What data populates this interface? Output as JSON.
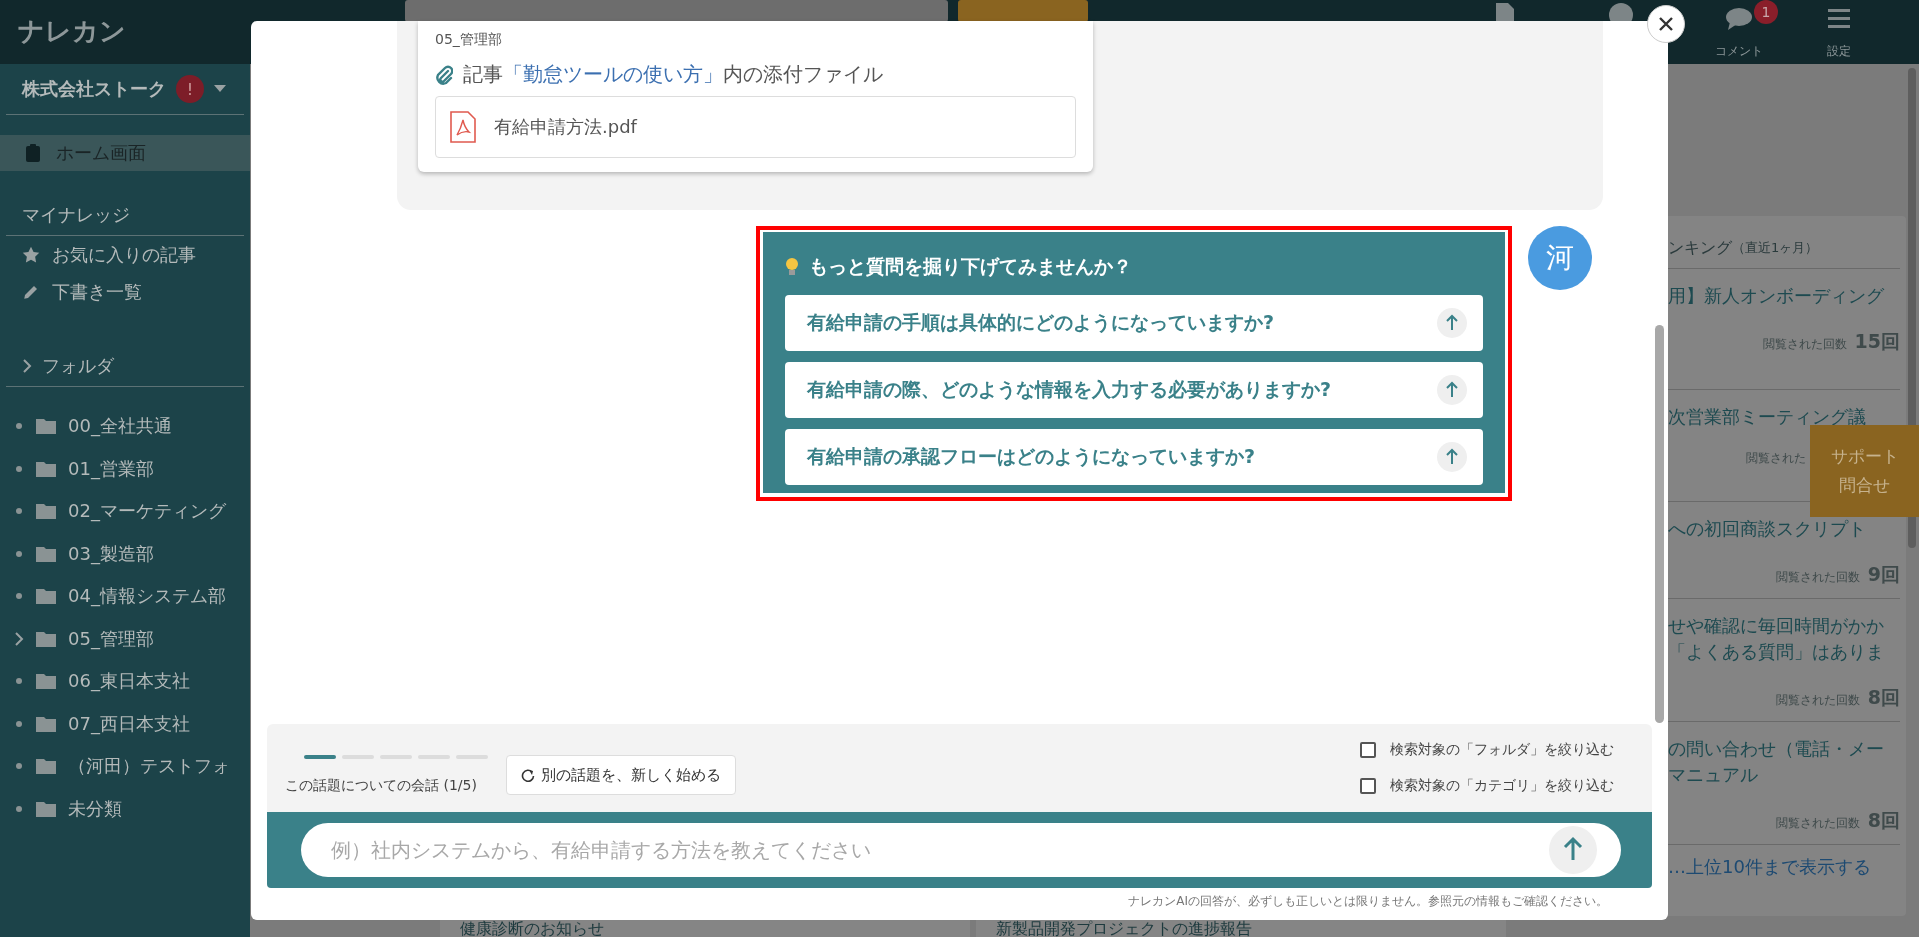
{
  "header": {
    "logo": "ナレカン",
    "comment_badge": "1",
    "comment_label": "コメント",
    "settings_label": "設定"
  },
  "sidebar": {
    "company": "株式会社ストーク",
    "alert_badge": "!",
    "nav": [
      {
        "label": "ホーム画面",
        "selected": true
      }
    ],
    "my_knowledge": {
      "heading": "マイナレッジ",
      "items": [
        {
          "kind": "star",
          "label": "お気に入りの記事"
        },
        {
          "kind": "pencil",
          "label": "下書き一覧"
        }
      ]
    },
    "folders": {
      "heading": "フォルダ",
      "items": [
        {
          "label": "00_全社共通",
          "has_children": false
        },
        {
          "label": "01_営業部",
          "has_children": false
        },
        {
          "label": "02_マーケティング",
          "has_children": false
        },
        {
          "label": "03_製造部",
          "has_children": false
        },
        {
          "label": "04_情報システム部",
          "has_children": false
        },
        {
          "label": "05_管理部",
          "has_children": true
        },
        {
          "label": "06_東日本支社",
          "has_children": false
        },
        {
          "label": "07_西日本支社",
          "has_children": false
        },
        {
          "label": "（河田）テストフォ",
          "has_children": false
        },
        {
          "label": "未分類",
          "has_children": false
        }
      ]
    }
  },
  "background_cards": [
    "健康診断のお知らせ",
    "新製品開発プロジェクトの進捗報告"
  ],
  "ranking": {
    "title": "ンキング",
    "period": "（直近1ヶ月）",
    "items": [
      {
        "lines": [
          "用】新人オンボーディング"
        ],
        "count_label": "閲覧された回数",
        "count": "15回"
      },
      {
        "lines": [
          "次営業部ミーティング議"
        ],
        "count_label": "閲覧された"
      },
      {
        "lines": [
          "への初回商談スクリプト"
        ],
        "count_label": "閲覧された回数",
        "count": "9回"
      },
      {
        "lines": [
          "せや確認に毎回時間がかか",
          "「よくある質問」はありま"
        ],
        "count_label": "閲覧された回数",
        "count": "8回"
      },
      {
        "lines": [
          "の問い合わせ（電話・メー",
          "マニュアル"
        ],
        "count_label": "閲覧された回数",
        "count": "8回"
      }
    ],
    "more_link": "…上位10件まで表示する"
  },
  "support_button": {
    "lines": [
      "サポート",
      "問合せ"
    ]
  },
  "chat": {
    "reference": {
      "folder": "05_管理部",
      "caption_prefix": "記事",
      "article_link": "「勤怠ツールの使い方」",
      "caption_suffix": "内の添付ファイル",
      "file": "有給申請方法.pdf"
    },
    "suggestions": {
      "title": "もっと質問を掘り下げてみませんか？",
      "items": [
        {
          "text": "有給申請の手順は具体的にどのようになっていますか?"
        },
        {
          "text": "有給申請の際、どのような情報を入力する必要がありますか?"
        },
        {
          "text": "有給申請の承認フローはどのようになっていますか?"
        }
      ]
    },
    "avatar": "河"
  },
  "composer": {
    "steps": [
      {
        "done": true
      },
      {
        "done": false
      },
      {
        "done": false
      },
      {
        "done": false
      },
      {
        "done": false
      }
    ],
    "topic_label": "この話題についての会話 (1/5)",
    "new_topic_button": "別の話題を、新しく始める",
    "filters": [
      {
        "label": "検索対象の「フォルダ」を絞り込む",
        "checked": false
      },
      {
        "label": "検索対象の「カテゴリ」を絞り込む",
        "checked": false
      }
    ],
    "placeholder": "例）社内システムから、有給申請する方法を教えてください",
    "disclaimer": "ナレカンAIの回答が、必ずしも正しいとは限りません。参照元の情報もご確認ください。"
  }
}
